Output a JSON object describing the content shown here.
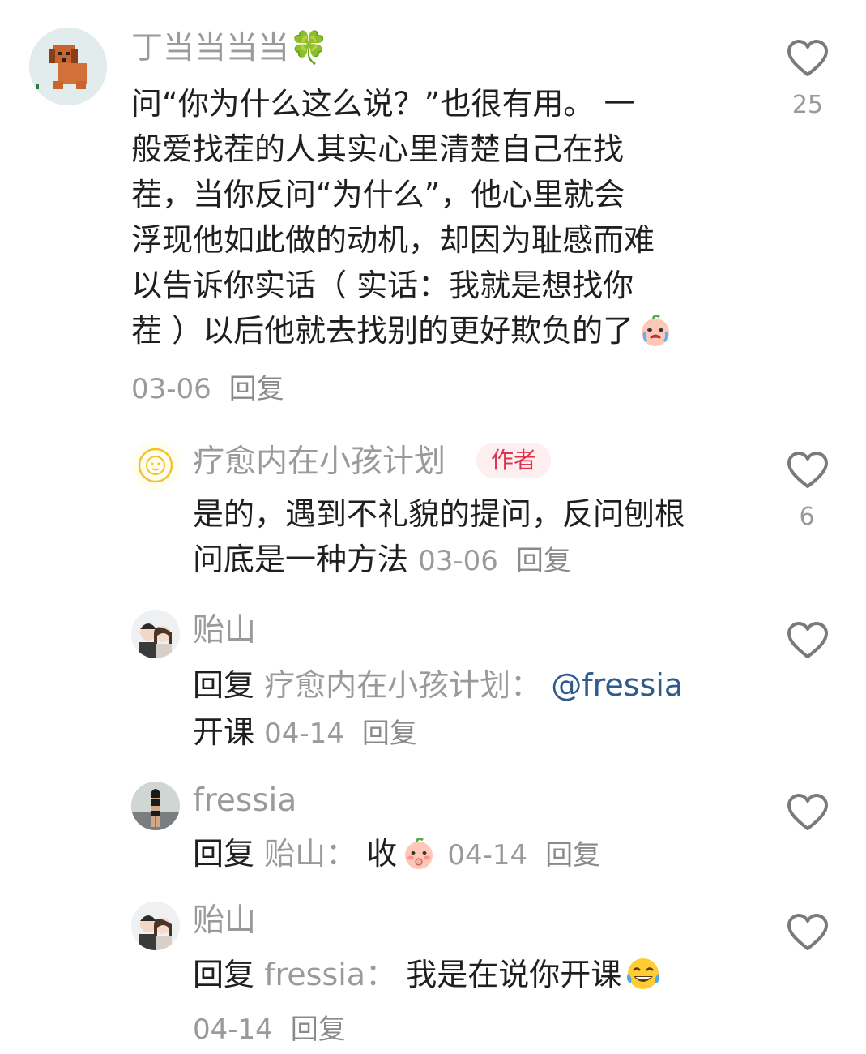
{
  "comments": [
    {
      "username": "丁当当当当🍀",
      "lines": [
        "问“你为什么这么说？”也很有用。 一",
        "般爱找茬的人其实心里清楚自己在找",
        "茬，当你反问“为什么”，他心里就会",
        "浮现他如此做的动机，却因为耻感而难",
        "以告诉你实话（ 实话：我就是想找你",
        "茬 ）以后他就去找别的更好欺负的了"
      ],
      "emoji": "crying-peach-emoji",
      "date": "03-06",
      "reply_label": "回复",
      "like_count": "25"
    },
    {
      "username": "疗愈内在小孩计划",
      "badge": "作者",
      "lines": [
        "是的，遇到不礼貌的提问，反问刨根",
        "问底是一种方法"
      ],
      "date": "03-06",
      "reply_label": "回复",
      "like_count": "6"
    },
    {
      "username": "贻山",
      "reply_prefix": "回复",
      "reply_target": "疗愈内在小孩计划：",
      "mention": "@fressia",
      "text_line2": "开课",
      "date": "04-14",
      "reply_label": "回复"
    },
    {
      "username": "fressia",
      "reply_prefix": "回复",
      "reply_target": "贻山：",
      "text": "收",
      "emoji": "shy-peach-emoji",
      "date": "04-14",
      "reply_label": "回复"
    },
    {
      "username": "贻山",
      "reply_prefix": "回复",
      "reply_target": "fressia：",
      "text": "我是在说你开课",
      "emoji": "tears-of-joy-emoji",
      "date": "04-14",
      "reply_label": "回复"
    }
  ],
  "colors": {
    "username": "#9a9a9a",
    "text": "#1f1f1f",
    "mention": "#2f5a8c",
    "badge_bg": "#fdeef0",
    "badge_text": "#e0334d"
  },
  "icons": [
    "heart-outline-icon"
  ]
}
